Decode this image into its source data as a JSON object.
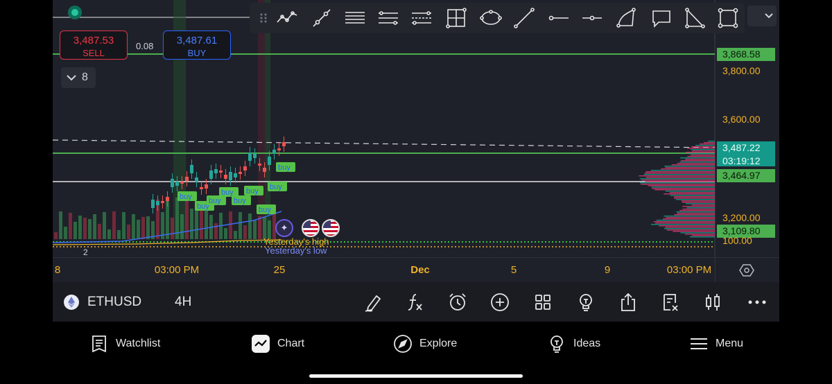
{
  "colors": {
    "background": "#1f212a",
    "axis_text": "#f0b429",
    "buy_blue": "#2962ff",
    "sell_red": "#f23645",
    "green_line": "#4caf50",
    "teal": "#14998a",
    "pink": "#d6386e"
  },
  "order_panel": {
    "sell_price": "3,487.53",
    "sell_label": "SELL",
    "spread": "0.08",
    "buy_price": "3,487.61",
    "buy_label": "BUY",
    "collapse_count": "8"
  },
  "drawing_toolbar": {
    "tools": [
      "grip-icon",
      "trend-line-icon",
      "ray-icon",
      "parallel-channel-icon",
      "fib-retracement-icon",
      "fib-extension-icon",
      "crosshair-box-icon",
      "ellipse-icon",
      "line-segment-icon",
      "horizontal-ray-icon",
      "horizontal-line-icon",
      "brush-curve-icon",
      "comment-icon",
      "triangle-icon",
      "rectangle-icon"
    ]
  },
  "price_scale": {
    "plain": [
      "3,800.00",
      "3,600.00",
      "3,200.00",
      "100.00"
    ],
    "green_tags": [
      "3,868.58",
      "3,464.97",
      "3,109.80"
    ],
    "current_price": "3,487.22",
    "countdown": "03:19:12"
  },
  "chart_labels": {
    "buy_signal": "buy",
    "yesterday_high": "Yesterday's high",
    "yesterday_low": "Yesterday's low",
    "collapse_tag": "2"
  },
  "x_axis": {
    "ticks": [
      "8",
      "03:00 PM",
      "25",
      "Dec",
      "5",
      "9",
      "03:00 PM"
    ]
  },
  "symbol_bar": {
    "symbol": "ETHUSD",
    "interval": "4H",
    "buttons": [
      "pen-icon",
      "indicators-fx-icon",
      "alarm-icon",
      "add-circle-icon",
      "grid-layout-icon",
      "lightbulb-icon",
      "share-icon",
      "clear-drawings-icon",
      "candle-type-icon",
      "more-icon"
    ]
  },
  "bottom_nav": {
    "watchlist": "Watchlist",
    "chart": "Chart",
    "explore": "Explore",
    "ideas": "Ideas",
    "menu": "Menu"
  }
}
